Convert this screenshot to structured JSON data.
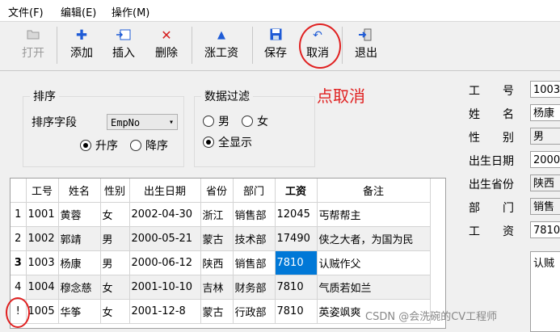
{
  "menu": [
    {
      "label": "文件(F)"
    },
    {
      "label": "编辑(E)"
    },
    {
      "label": "操作(M)"
    }
  ],
  "toolbar": {
    "open": "打开",
    "add": "添加",
    "insert": "插入",
    "delete": "删除",
    "raise": "涨工资",
    "save": "保存",
    "cancel": "取消",
    "exit": "退出"
  },
  "sort": {
    "title": "排序",
    "field_label": "排序字段",
    "field_value": "EmpNo",
    "asc": "升序",
    "desc": "降序"
  },
  "filter": {
    "title": "数据过滤",
    "male": "男",
    "female": "女",
    "all": "全显示"
  },
  "annotation": "点取消",
  "grid": {
    "headers": [
      "工号",
      "姓名",
      "性别",
      "出生日期",
      "省份",
      "部门",
      "工资",
      "备注"
    ],
    "rows": [
      {
        "num": "1",
        "cells": [
          "1001",
          "黄蓉",
          "女",
          "2002-04-30",
          "浙江",
          "销售部",
          "12045",
          "丐帮帮主"
        ]
      },
      {
        "num": "2",
        "cells": [
          "1002",
          "郭靖",
          "男",
          "2000-05-21",
          "蒙古",
          "技术部",
          "17490",
          "侠之大者，为国为民"
        ]
      },
      {
        "num": "3",
        "cells": [
          "1003",
          "杨康",
          "男",
          "2000-06-12",
          "陕西",
          "销售部",
          "7810",
          "认贼作父"
        ]
      },
      {
        "num": "4",
        "cells": [
          "1004",
          "穆念慈",
          "女",
          "2001-10-10",
          "吉林",
          "财务部",
          "7810",
          "气质若如兰"
        ]
      },
      {
        "num": "!",
        "cells": [
          "1005",
          "华筝",
          "女",
          "2001-12-8",
          "蒙古",
          "行政部",
          "7810",
          "英姿飒爽"
        ]
      }
    ]
  },
  "detail": {
    "labels": [
      "工　　号",
      "姓　　名",
      "性　　别",
      "出生日期",
      "出生省份",
      "部　　门",
      "工　　资"
    ],
    "values": [
      "1003",
      "杨康",
      "男",
      "2000",
      "陕西",
      "销售",
      "7810"
    ],
    "memo": "认贼"
  },
  "watermark": "CSDN @会洗碗的CV工程师"
}
